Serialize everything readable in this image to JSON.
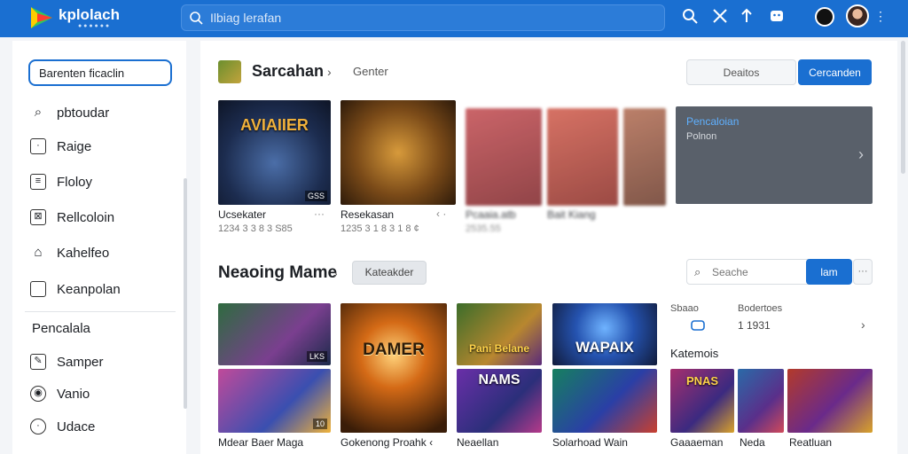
{
  "topbar": {
    "brand": "kplolach",
    "brand_sub": "● ● ● ● ● ●",
    "search_placeholder": "Ilbiag lerafan",
    "icons": [
      "search-icon",
      "tools-icon",
      "arrow-icon",
      "gamepad-icon"
    ]
  },
  "sidebar": {
    "search_value": "Barenten ficaclin",
    "items": [
      {
        "icon": "search-icon",
        "label": "pbtoudar"
      },
      {
        "icon": "page-icon",
        "label": "Raige"
      },
      {
        "icon": "grid-icon",
        "label": "Floloy"
      },
      {
        "icon": "relation-icon",
        "label": "Rellcoloin"
      },
      {
        "icon": "house-icon",
        "label": "Kahelfeo"
      },
      {
        "icon": "box-icon",
        "label": "Keanpolan"
      }
    ],
    "section_head": "Pencalala",
    "items2": [
      {
        "icon": "edit-icon",
        "label": "Samper"
      },
      {
        "icon": "eye-icon",
        "label": "Vanio"
      },
      {
        "icon": "clock-icon",
        "label": "Udace"
      }
    ]
  },
  "section1": {
    "title": "Sarcahan",
    "subtitle": "Genter",
    "btn_ghost": "Deaitos",
    "btn_primary": "Cercanden",
    "cards": [
      {
        "title": "AVIAIIER",
        "badge": "GSS",
        "label": "Ucsekater",
        "meta": "1234 3 3 8 3 S85"
      },
      {
        "title": "",
        "badge": "",
        "label": "Resekasan",
        "meta": "1235 3 1 8 3 1 8 ¢"
      },
      {
        "title": "",
        "badge": "",
        "label": "Pcaaia.atb",
        "meta": "2535.55"
      },
      {
        "title": "",
        "badge": "",
        "label": "Bait Kiang",
        "meta": ""
      }
    ],
    "panel": {
      "line1": "Pencaloian",
      "line2": "Polnon"
    }
  },
  "section2": {
    "title": "Neaoing Mame",
    "chip": "Kateakder",
    "search_placeholder": "Seache",
    "search_btn": "lam",
    "more": "···",
    "stats": [
      {
        "label": "Sbaao",
        "value": "Bodertoes"
      },
      {
        "label": "",
        "value": "1 1931"
      }
    ],
    "k_head": "Katemois",
    "cards": [
      {
        "title": "",
        "badge": "LKS",
        "label": "Mdear Baer Maga"
      },
      {
        "title": "",
        "badge": "10",
        "label": ""
      },
      {
        "title": "DAMER",
        "badge": "",
        "label": "Gokenong Proahk ‹"
      },
      {
        "title": "Pani Belane",
        "badge": "",
        "label": ""
      },
      {
        "title": "NAMS",
        "badge": "",
        "label": "Neaellan"
      },
      {
        "title": "WAPAIX",
        "badge": "",
        "label": "Solarhoad Wain"
      },
      {
        "title": "",
        "badge": "",
        "label": ""
      },
      {
        "title": "PNAS",
        "badge": "",
        "label": "Gaaaeman"
      },
      {
        "title": "",
        "badge": "",
        "label": "Neda"
      },
      {
        "title": "",
        "badge": "",
        "label": "Reatluan"
      }
    ]
  },
  "colors": {
    "accent": "#1a6fd1",
    "panel": "#59606a"
  }
}
